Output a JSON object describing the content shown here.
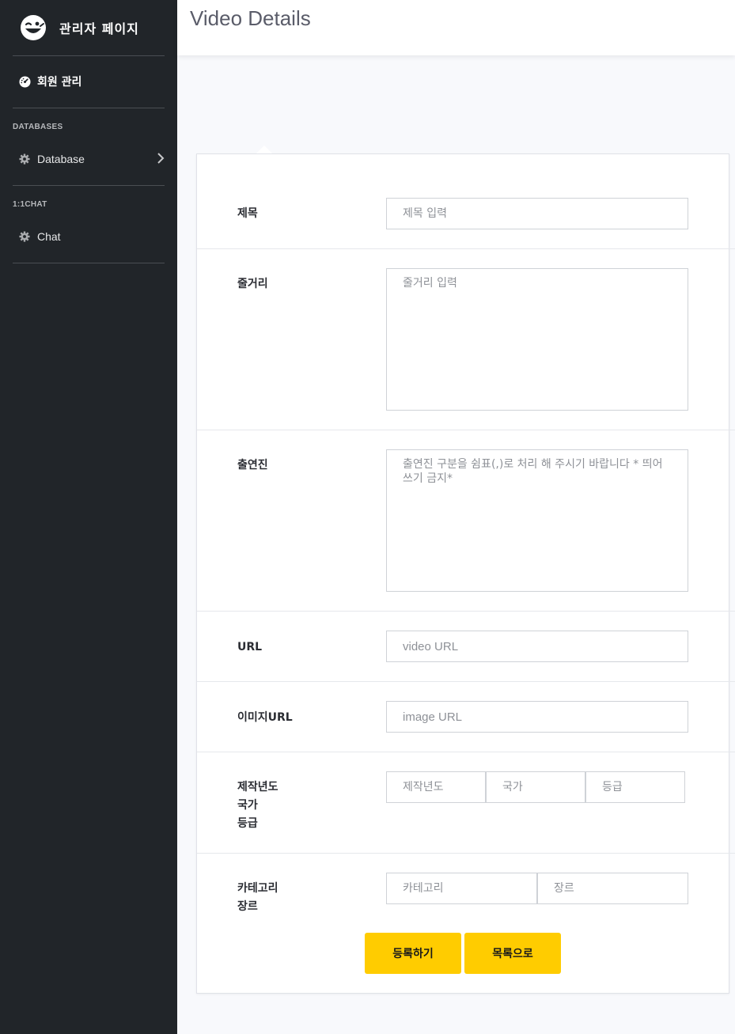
{
  "brand": {
    "title": "관리자 페이지",
    "logo_icon": "wink-face-icon"
  },
  "sidebar": {
    "dashboard_label": "회원 관리",
    "section_databases": "DATABASES",
    "database_label": "Database",
    "section_chat": "1:1CHAT",
    "chat_label": "Chat"
  },
  "header": {
    "title": "Video Details"
  },
  "form": {
    "title_label": "제목",
    "title_placeholder": "제목 입력",
    "plot_label": "줄거리",
    "plot_placeholder": "줄거리 입력",
    "cast_label": "출연진",
    "cast_placeholder": "출연진 구분을 쉼표(,)로 처리 해 주시기 바랍니다 * 띄어쓰기 금지*",
    "url_label": "URL",
    "url_placeholder": "video URL",
    "image_label": "이미지URL",
    "image_placeholder": "image URL",
    "meta_labels": [
      "제작년도",
      "국가",
      "등급"
    ],
    "year_placeholder": "제작년도",
    "country_placeholder": "국가",
    "rating_placeholder": "등급",
    "category_labels": [
      "카테고리",
      "장르"
    ],
    "category_placeholder": "카테고리",
    "genre_placeholder": "장르",
    "submit_label": "등록하기",
    "list_label": "목록으로"
  },
  "colors": {
    "sidebar_bg": "#212529",
    "accent": "#ffcc00",
    "page_bg": "#f8f9fc"
  }
}
